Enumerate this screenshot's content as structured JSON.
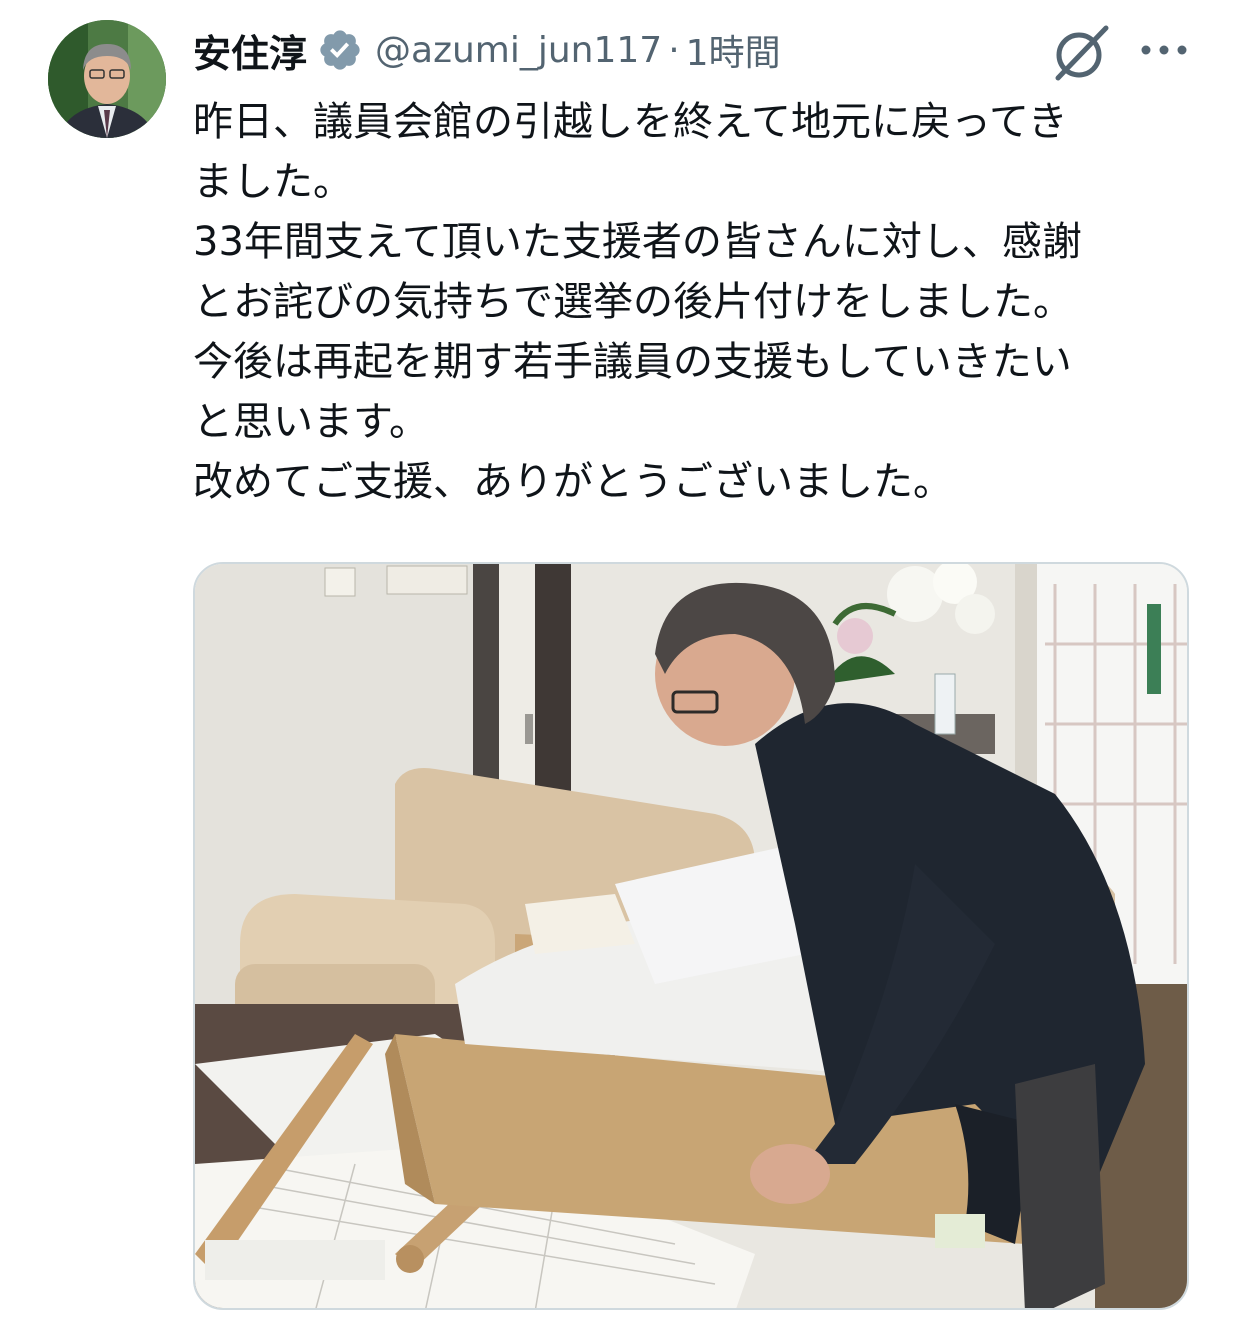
{
  "author": {
    "name": "安住淳",
    "handle": "@azumi_jun117",
    "separator": "·",
    "time": "1時間",
    "verified": true
  },
  "tweet": {
    "lines": [
      "昨日、議員会館の引越しを終えて地元に戻ってき",
      "ました。",
      "33年間支えて頂いた支援者の皆さんに対し、感謝",
      "とお詫びの気持ちで選挙の後片付けをしました。",
      "今後は再起を期す若手議員の支援もしていきたい",
      "と思います。",
      "改めてご支援、ありがとうございました。"
    ]
  },
  "icons": {
    "verified": "verified-badge-icon",
    "grok": "grok-icon",
    "more": "more-options-icon"
  },
  "colors": {
    "text": "#0f1419",
    "secondary": "#536471",
    "badge": "#829aab",
    "border": "#cfd9de"
  }
}
